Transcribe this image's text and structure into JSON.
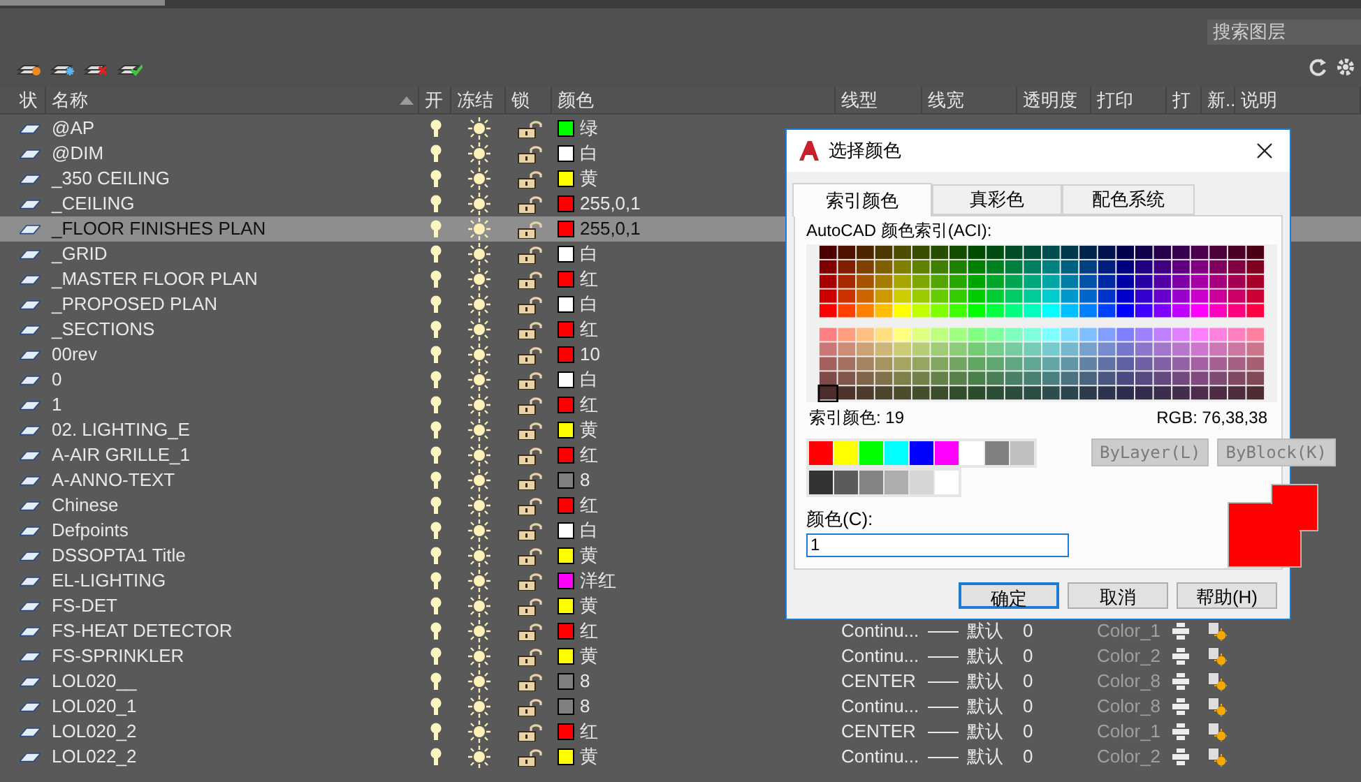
{
  "search": {
    "placeholder": "搜索图层"
  },
  "columns": [
    {
      "label": "状",
      "kind": "status"
    },
    {
      "label": "名称",
      "kind": "name"
    },
    {
      "label": "开",
      "kind": "on"
    },
    {
      "label": "冻结",
      "kind": "frozen"
    },
    {
      "label": "锁",
      "kind": "locked"
    },
    {
      "label": "颜色",
      "kind": "color"
    },
    {
      "label": "线型",
      "kind": "linetype"
    },
    {
      "label": "线宽",
      "kind": "lineweight"
    },
    {
      "label": "透明度",
      "kind": "transparency"
    },
    {
      "label": "打印",
      "kind": "plot_style"
    },
    {
      "label": "打",
      "kind": "plot"
    },
    {
      "label": "新..",
      "kind": "newvp"
    },
    {
      "label": "说明",
      "kind": "description"
    }
  ],
  "layers": [
    {
      "name": "@AP",
      "on": true,
      "frozen": false,
      "locked": false,
      "color": "#00ff00",
      "color_name": "绿",
      "selected": false
    },
    {
      "name": "@DIM",
      "on": true,
      "frozen": false,
      "locked": false,
      "color": "#ffffff",
      "color_name": "白",
      "selected": false
    },
    {
      "name": "_350 CEILING",
      "on": true,
      "frozen": false,
      "locked": false,
      "color": "#ffff00",
      "color_name": "黄",
      "selected": false
    },
    {
      "name": "_CEILING",
      "on": true,
      "frozen": false,
      "locked": false,
      "color": "#ff0001",
      "color_name": "255,0,1",
      "selected": false
    },
    {
      "name": "_FLOOR FINISHES PLAN",
      "on": true,
      "frozen": false,
      "locked": false,
      "color": "#ff0001",
      "color_name": "255,0,1",
      "selected": true
    },
    {
      "name": "_GRID",
      "on": true,
      "frozen": false,
      "locked": false,
      "color": "#ffffff",
      "color_name": "白",
      "selected": false
    },
    {
      "name": "_MASTER FLOOR PLAN",
      "on": true,
      "frozen": false,
      "locked": false,
      "color": "#ff0000",
      "color_name": "红",
      "selected": false
    },
    {
      "name": "_PROPOSED PLAN",
      "on": true,
      "frozen": false,
      "locked": false,
      "color": "#ffffff",
      "color_name": "白",
      "selected": false
    },
    {
      "name": "_SECTIONS",
      "on": true,
      "frozen": false,
      "locked": false,
      "color": "#ff0000",
      "color_name": "红",
      "selected": false
    },
    {
      "name": "00rev",
      "on": true,
      "frozen": false,
      "locked": false,
      "color": "#ff0000",
      "color_name": "10",
      "selected": false
    },
    {
      "name": "0",
      "on": true,
      "frozen": false,
      "locked": false,
      "color": "#ffffff",
      "color_name": "白",
      "selected": false
    },
    {
      "name": "1",
      "on": true,
      "frozen": false,
      "locked": false,
      "color": "#ff0000",
      "color_name": "红",
      "selected": false
    },
    {
      "name": "02. LIGHTING_E",
      "on": true,
      "frozen": false,
      "locked": false,
      "color": "#ffff00",
      "color_name": "黄",
      "selected": false
    },
    {
      "name": "A-AIR GRILLE_1",
      "on": true,
      "frozen": false,
      "locked": false,
      "color": "#ff0000",
      "color_name": "红",
      "selected": false
    },
    {
      "name": "A-ANNO-TEXT",
      "on": true,
      "frozen": false,
      "locked": false,
      "color": "#808080",
      "color_name": "8",
      "selected": false
    },
    {
      "name": "Chinese",
      "on": true,
      "frozen": false,
      "locked": false,
      "color": "#ff0000",
      "color_name": "红",
      "selected": false
    },
    {
      "name": "Defpoints",
      "on": true,
      "frozen": false,
      "locked": false,
      "color": "#ffffff",
      "color_name": "白",
      "selected": false
    },
    {
      "name": "DSSOPTA1 Title",
      "on": true,
      "frozen": false,
      "locked": false,
      "color": "#ffff00",
      "color_name": "黄",
      "selected": false
    },
    {
      "name": "EL-LIGHTING",
      "on": true,
      "frozen": false,
      "locked": false,
      "color": "#ff00ff",
      "color_name": "洋红",
      "selected": false
    },
    {
      "name": "FS-DET",
      "on": true,
      "frozen": false,
      "locked": false,
      "color": "#ffff00",
      "color_name": "黄",
      "selected": false
    },
    {
      "name": "FS-HEAT DETECTOR",
      "on": true,
      "frozen": false,
      "locked": false,
      "color": "#ff0000",
      "color_name": "红",
      "selected": false,
      "linetype": "Continu...",
      "lineweight": "默认",
      "transparency": "0",
      "plot_style": "Color_1"
    },
    {
      "name": "FS-SPRINKLER",
      "on": true,
      "frozen": false,
      "locked": false,
      "color": "#ffff00",
      "color_name": "黄",
      "selected": false,
      "linetype": "Continu...",
      "lineweight": "默认",
      "transparency": "0",
      "plot_style": "Color_2"
    },
    {
      "name": "LOL020__",
      "on": true,
      "frozen": false,
      "locked": false,
      "color": "#808080",
      "color_name": "8",
      "selected": false,
      "linetype": "CENTER",
      "lineweight": "默认",
      "transparency": "0",
      "plot_style": "Color_8"
    },
    {
      "name": "LOL020_1",
      "on": true,
      "frozen": false,
      "locked": false,
      "color": "#808080",
      "color_name": "8",
      "selected": false,
      "linetype": "Continu...",
      "lineweight": "默认",
      "transparency": "0",
      "plot_style": "Color_8"
    },
    {
      "name": "LOL020_2",
      "on": true,
      "frozen": false,
      "locked": false,
      "color": "#ff0000",
      "color_name": "红",
      "selected": false,
      "linetype": "CENTER",
      "lineweight": "默认",
      "transparency": "0",
      "plot_style": "Color_1"
    },
    {
      "name": "LOL022_2",
      "on": true,
      "frozen": false,
      "locked": false,
      "color": "#ffff00",
      "color_name": "黄",
      "selected": false,
      "linetype": "Continu...",
      "lineweight": "默认",
      "transparency": "0",
      "plot_style": "Color_2"
    }
  ],
  "dialog": {
    "title": "选择颜色",
    "tabs": [
      {
        "label": "索引颜色",
        "selected": true
      },
      {
        "label": "真彩色",
        "selected": false
      },
      {
        "label": "配色系统",
        "selected": false
      }
    ],
    "palette_label": "AutoCAD 颜色索引(ACI):",
    "index_reading": "索引颜色: 19",
    "rgb_reading": "RGB: 76,38,38",
    "standard_colors": [
      {
        "color": "#ff0000"
      },
      {
        "color": "#ffff00"
      },
      {
        "color": "#00ff00"
      },
      {
        "color": "#00ffff"
      },
      {
        "color": "#0000ff"
      },
      {
        "color": "#ff00ff"
      },
      {
        "color": "#ffffff"
      },
      {
        "color": "#808080"
      },
      {
        "color": "#c0c0c0"
      }
    ],
    "gray_colors": [
      {
        "color": "#333333"
      },
      {
        "color": "#5b5b5b"
      },
      {
        "color": "#848484"
      },
      {
        "color": "#adadad"
      },
      {
        "color": "#d6d6d6"
      },
      {
        "color": "#ffffff"
      }
    ],
    "bylayer": {
      "label": "ByLayer(L)",
      "disabled": true
    },
    "byblock": {
      "label": "ByBlock(K)",
      "disabled": true
    },
    "color_field": {
      "label": "颜色(C):",
      "value": "1"
    },
    "preview": [
      {
        "kind": "old",
        "color": "#ff0000"
      },
      {
        "kind": "new",
        "color": "#ff0000"
      }
    ],
    "buttons": [
      {
        "label": "确定",
        "kind": "default"
      },
      {
        "label": "取消",
        "kind": "normal"
      },
      {
        "label": "帮助(H)",
        "kind": "normal"
      }
    ]
  }
}
